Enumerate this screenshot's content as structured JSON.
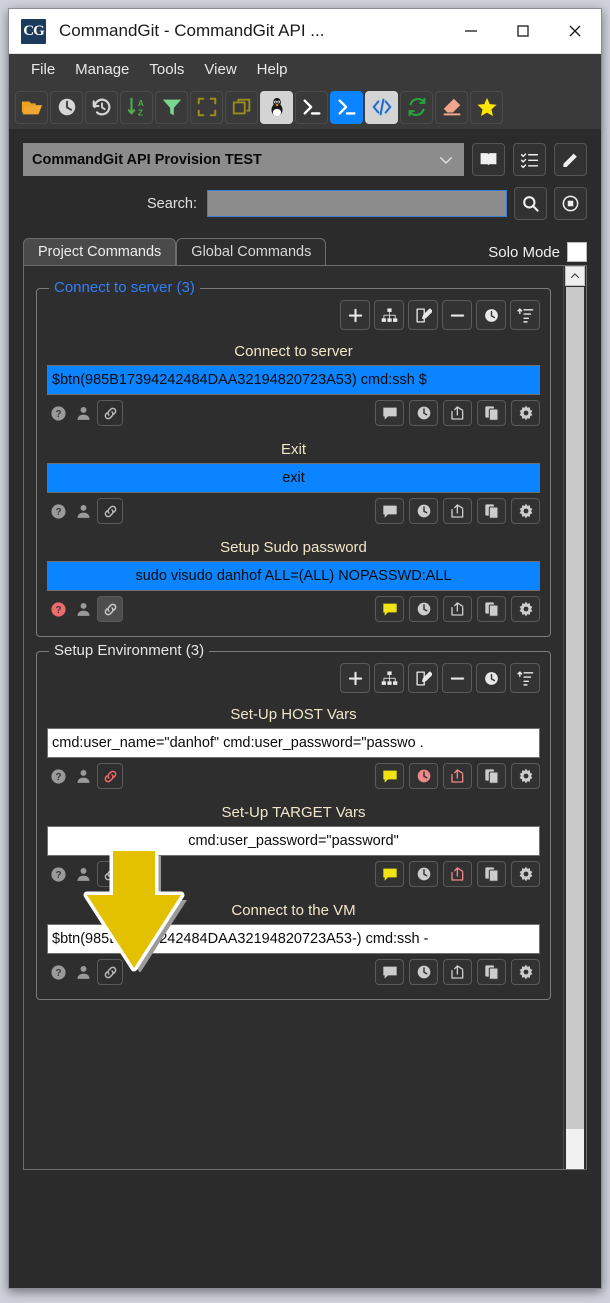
{
  "window": {
    "title": "CommandGit - CommandGit API ...",
    "app_icon": "CG",
    "controls": {
      "minimize": "minimize-icon",
      "maximize": "maximize-icon",
      "close": "close-icon"
    }
  },
  "menubar": {
    "items": [
      "File",
      "Manage",
      "Tools",
      "View",
      "Help"
    ]
  },
  "toolbar": {
    "buttons": [
      {
        "name": "open-folder-icon",
        "state": "normal"
      },
      {
        "name": "clock-icon",
        "state": "normal"
      },
      {
        "name": "history-icon",
        "state": "normal"
      },
      {
        "name": "sort-az-icon",
        "state": "normal"
      },
      {
        "name": "filter-icon",
        "state": "normal"
      },
      {
        "name": "fullscreen-icon",
        "state": "normal"
      },
      {
        "name": "copy-windows-icon",
        "state": "normal"
      },
      {
        "name": "linux-penguin-icon",
        "state": "lit"
      },
      {
        "name": "terminal-icon",
        "state": "normal"
      },
      {
        "name": "powershell-icon",
        "state": "blue"
      },
      {
        "name": "code-icon",
        "state": "lit"
      },
      {
        "name": "refresh-icon",
        "state": "normal"
      },
      {
        "name": "eraser-icon",
        "state": "normal"
      },
      {
        "name": "favorite-star-icon",
        "state": "normal"
      }
    ]
  },
  "project": {
    "selected": "CommandGit API Provision TEST",
    "buttons": [
      {
        "name": "book-icon"
      },
      {
        "name": "checklist-icon"
      },
      {
        "name": "pencil-icon"
      }
    ]
  },
  "search": {
    "label": "Search:",
    "value": "",
    "placeholder": "",
    "buttons": [
      {
        "name": "search-icon"
      },
      {
        "name": "record-icon"
      }
    ]
  },
  "tabs": {
    "items": [
      {
        "label": "Project Commands",
        "active": true
      },
      {
        "label": "Global Commands",
        "active": false
      }
    ],
    "solo_mode_label": "Solo Mode",
    "solo_mode_checked": false
  },
  "group_tools": [
    {
      "name": "add-icon"
    },
    {
      "name": "tree-icon"
    },
    {
      "name": "edit-icon"
    },
    {
      "name": "remove-icon"
    },
    {
      "name": "clock-icon"
    },
    {
      "name": "sort-icon"
    }
  ],
  "groups": [
    {
      "title": "Connect to server (3)",
      "title_color": "blue",
      "commands": [
        {
          "title": "Connect to server",
          "value": "$btn(985B17394242484DAA32194820723A53) cmd:ssh $",
          "field_style": "blue",
          "align": "left",
          "left_icons": [
            {
              "name": "help-icon",
              "color": "grey",
              "boxed": false
            },
            {
              "name": "user-icon",
              "color": "grey",
              "boxed": false
            },
            {
              "name": "link-icon",
              "color": "grey",
              "boxed": true,
              "filled": false
            }
          ],
          "right_icons": [
            {
              "name": "comment-icon",
              "color": "grey"
            },
            {
              "name": "clock-icon",
              "color": "grey"
            },
            {
              "name": "share-icon",
              "color": "grey"
            },
            {
              "name": "copy-icon",
              "color": "grey"
            },
            {
              "name": "gear-icon",
              "color": "grey"
            }
          ]
        },
        {
          "title": "Exit",
          "value": "exit",
          "field_style": "blue",
          "align": "center",
          "left_icons": [
            {
              "name": "help-icon",
              "color": "grey",
              "boxed": false
            },
            {
              "name": "user-icon",
              "color": "grey",
              "boxed": false
            },
            {
              "name": "link-icon",
              "color": "grey",
              "boxed": true,
              "filled": false
            }
          ],
          "right_icons": [
            {
              "name": "comment-icon",
              "color": "grey"
            },
            {
              "name": "clock-icon",
              "color": "grey"
            },
            {
              "name": "share-icon",
              "color": "grey"
            },
            {
              "name": "copy-icon",
              "color": "grey"
            },
            {
              "name": "gear-icon",
              "color": "grey"
            }
          ]
        },
        {
          "title": "Setup Sudo password",
          "value": "sudo visudo danhof  ALL=(ALL) NOPASSWD:ALL",
          "field_style": "blue",
          "align": "center",
          "left_icons": [
            {
              "name": "help-icon",
              "color": "red",
              "boxed": false
            },
            {
              "name": "user-icon",
              "color": "grey",
              "boxed": false
            },
            {
              "name": "link-icon",
              "color": "grey",
              "boxed": true,
              "filled": true
            }
          ],
          "right_icons": [
            {
              "name": "comment-icon",
              "color": "yellow"
            },
            {
              "name": "clock-icon",
              "color": "grey"
            },
            {
              "name": "share-icon",
              "color": "grey"
            },
            {
              "name": "copy-icon",
              "color": "grey"
            },
            {
              "name": "gear-icon",
              "color": "grey"
            }
          ]
        }
      ]
    },
    {
      "title": "Setup Environment (3)",
      "title_color": "grey",
      "commands": [
        {
          "title": "Set-Up HOST Vars",
          "value": "cmd:user_name=\"danhof\" cmd:user_password=\"passwo .",
          "field_style": "white",
          "align": "left",
          "left_icons": [
            {
              "name": "help-icon",
              "color": "grey",
              "boxed": false
            },
            {
              "name": "user-icon",
              "color": "grey",
              "boxed": false
            },
            {
              "name": "link-icon",
              "color": "red",
              "boxed": true,
              "filled": false
            }
          ],
          "right_icons": [
            {
              "name": "comment-icon",
              "color": "yellow"
            },
            {
              "name": "clock-icon",
              "color": "red"
            },
            {
              "name": "share-icon",
              "color": "red"
            },
            {
              "name": "copy-icon",
              "color": "grey"
            },
            {
              "name": "gear-icon",
              "color": "grey"
            }
          ]
        },
        {
          "title": "Set-Up TARGET Vars",
          "value": "cmd:user_password=\"password\"",
          "field_style": "white",
          "align": "center",
          "left_icons": [
            {
              "name": "help-icon",
              "color": "grey",
              "boxed": false
            },
            {
              "name": "user-icon",
              "color": "grey",
              "boxed": false
            },
            {
              "name": "link-icon",
              "color": "grey",
              "boxed": true,
              "filled": false
            }
          ],
          "right_icons": [
            {
              "name": "comment-icon",
              "color": "yellow"
            },
            {
              "name": "clock-icon",
              "color": "grey"
            },
            {
              "name": "share-icon",
              "color": "red"
            },
            {
              "name": "copy-icon",
              "color": "grey"
            },
            {
              "name": "gear-icon",
              "color": "grey"
            }
          ]
        },
        {
          "title": "Connect to the VM",
          "value": "$btn(985B17394242484DAA32194820723A53-) cmd:ssh -",
          "field_style": "white",
          "align": "left",
          "left_icons": [
            {
              "name": "help-icon",
              "color": "grey",
              "boxed": false
            },
            {
              "name": "user-icon",
              "color": "grey",
              "boxed": false
            },
            {
              "name": "link-icon",
              "color": "grey",
              "boxed": true,
              "filled": false
            }
          ],
          "right_icons": [
            {
              "name": "comment-icon",
              "color": "grey"
            },
            {
              "name": "clock-icon",
              "color": "grey"
            },
            {
              "name": "share-icon",
              "color": "grey"
            },
            {
              "name": "copy-icon",
              "color": "grey"
            },
            {
              "name": "gear-icon",
              "color": "grey"
            }
          ]
        }
      ]
    }
  ],
  "annotation": {
    "name": "yellow-arrow-pointer",
    "color": "#e3c000",
    "points_to": "link-icon"
  },
  "colors": {
    "accent_blue": "#0a84ff",
    "group_title_blue": "#2f7ffb",
    "command_title": "#f2e6c9",
    "red": "#f08080",
    "yellow": "#f2e313",
    "window_bg": "#2b2b2b"
  },
  "scrollbar": {
    "name": "vertical-scrollbar",
    "up_arrow": "chevron-up-icon"
  }
}
